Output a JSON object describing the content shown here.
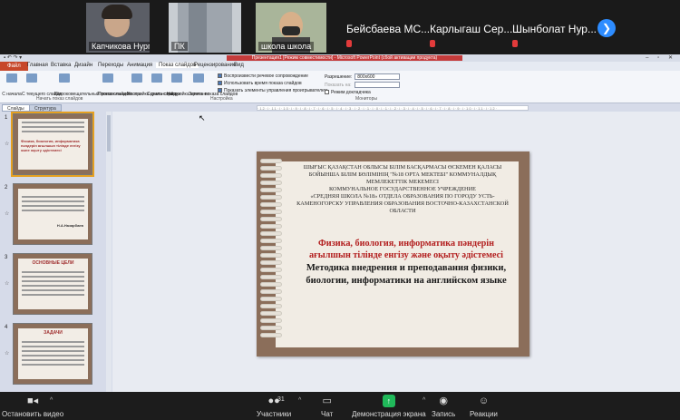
{
  "video_strip": {
    "tiles": [
      {
        "name": "Капчикова Нург..."
      },
      {
        "name": "ПК"
      },
      {
        "name": "школа школа"
      }
    ],
    "name_tiles": [
      {
        "name": "Бейсбаева МС..."
      },
      {
        "name": "Карлыгаш Сер..."
      },
      {
        "name": "Шынболат Нур..."
      }
    ],
    "next_icon": "chevron-right-icon"
  },
  "ppt": {
    "title": "Презентация1 [Режим совместимости] - Microsoft PowerPoint (сбой активации продукта)",
    "tabs": [
      "Файл",
      "Главная",
      "Вставка",
      "Дизайн",
      "Переходы",
      "Анимация",
      "Показ слайдов",
      "Рецензирование",
      "Вид"
    ],
    "ribbon_buttons": [
      {
        "label": "С начала",
        "icon": "play-icon"
      },
      {
        "label": "С текущего слайда",
        "icon": "play-current-icon"
      },
      {
        "label": "Широковещательный показ слайдов",
        "icon": "broadcast-icon"
      },
      {
        "label": "Произвольный показ",
        "icon": "custom-show-icon"
      },
      {
        "label": "Настройка демонстрации",
        "icon": "setup-icon"
      },
      {
        "label": "Скрыть слайд",
        "icon": "hide-slide-icon"
      },
      {
        "label": "Настройка времени",
        "icon": "timing-icon"
      },
      {
        "label": "Запись показа слайдов",
        "icon": "record-icon"
      }
    ],
    "group_labels": {
      "start": "Начать показ слайдов",
      "setup": "Настройка",
      "monitors": "Мониторы"
    },
    "checkboxes": [
      {
        "label": "Воспроизвести речевое сопровождение",
        "checked": true
      },
      {
        "label": "Использовать время показа слайдов",
        "checked": true
      },
      {
        "label": "Показать элементы управления проигрывателем",
        "checked": true
      }
    ],
    "monitors": {
      "resolution_label": "Разрешение:",
      "resolution_value": "800x600",
      "show_on_label": "Показать на:",
      "presenter_mode": "Режим докладчика"
    },
    "pane_tabs": [
      "Слайды",
      "Структура"
    ],
    "thumbnails": [
      {
        "num": "1",
        "text": "Физика, биология, информатика пәндерін ағылшын тілінде енгізу және оқыту әдістемесі",
        "selected": true
      },
      {
        "num": "2",
        "text": "Н.А.Назарбаев",
        "selected": false
      },
      {
        "num": "3",
        "text": "ОСНОВНЫЕ ЦЕЛИ",
        "selected": false
      },
      {
        "num": "4",
        "text": "ЗАДАЧИ",
        "selected": false
      }
    ],
    "ruler_text": "·12·|·11·|·10·|·9·|·8·|·7·|·6·|·5·|·4·|·3·|·2·|·1·|·0·|·1·|·2·|·3·|·4·|·5·|·6·|·7·|·8·|·9·|·10·|·11·|·12·",
    "slide": {
      "header_lines": [
        "ШЫҒЫС ҚАЗАҚСТАН ОБЛЫСЫ БІЛІМ БАСҚАРМАСЫ ӨСКЕМЕН ҚАЛАСЫ",
        "БОЙЫНША БІЛІМ БӨЛІМІНІҢ \"№18 ОРТА МЕКТЕБІ\" КОММУНАЛДЫҚ",
        "МЕМЛЕКЕТТІК МЕКЕМЕСІ",
        "КОММУНАЛЬНОЕ ГОСУДАРСТВЕННОЕ УЧРЕЖДЕНИЕ",
        "«СРЕДНЯЯ ШКОЛА №18» ОТДЕЛА ОБРАЗОВАНИЯ ПО ГОРОДУ УСТЬ-",
        "КАМЕНОГОРСКУ УПРАВЛЕНИЯ ОБРАЗОВАНИЯ ВОСТОЧНО-КАЗАХСТАНСКОЙ",
        "ОБЛАСТИ"
      ],
      "kaz_title_1": "Физика, биология, информатика пәндерін",
      "kaz_title_2": "ағылшын тілінде енгізу және оқыту әдістемесі",
      "rus_title_1": "Методика внедрения и преподавания физики,",
      "rus_title_2": "биологии, информатики  на английском языке"
    }
  },
  "toolbar": {
    "stop_video": "Остановить видео",
    "participants": "Участники",
    "participants_count": "31",
    "chat": "Чат",
    "share": "Демонстрация экрана",
    "record": "Запись",
    "reactions": "Реакции"
  }
}
